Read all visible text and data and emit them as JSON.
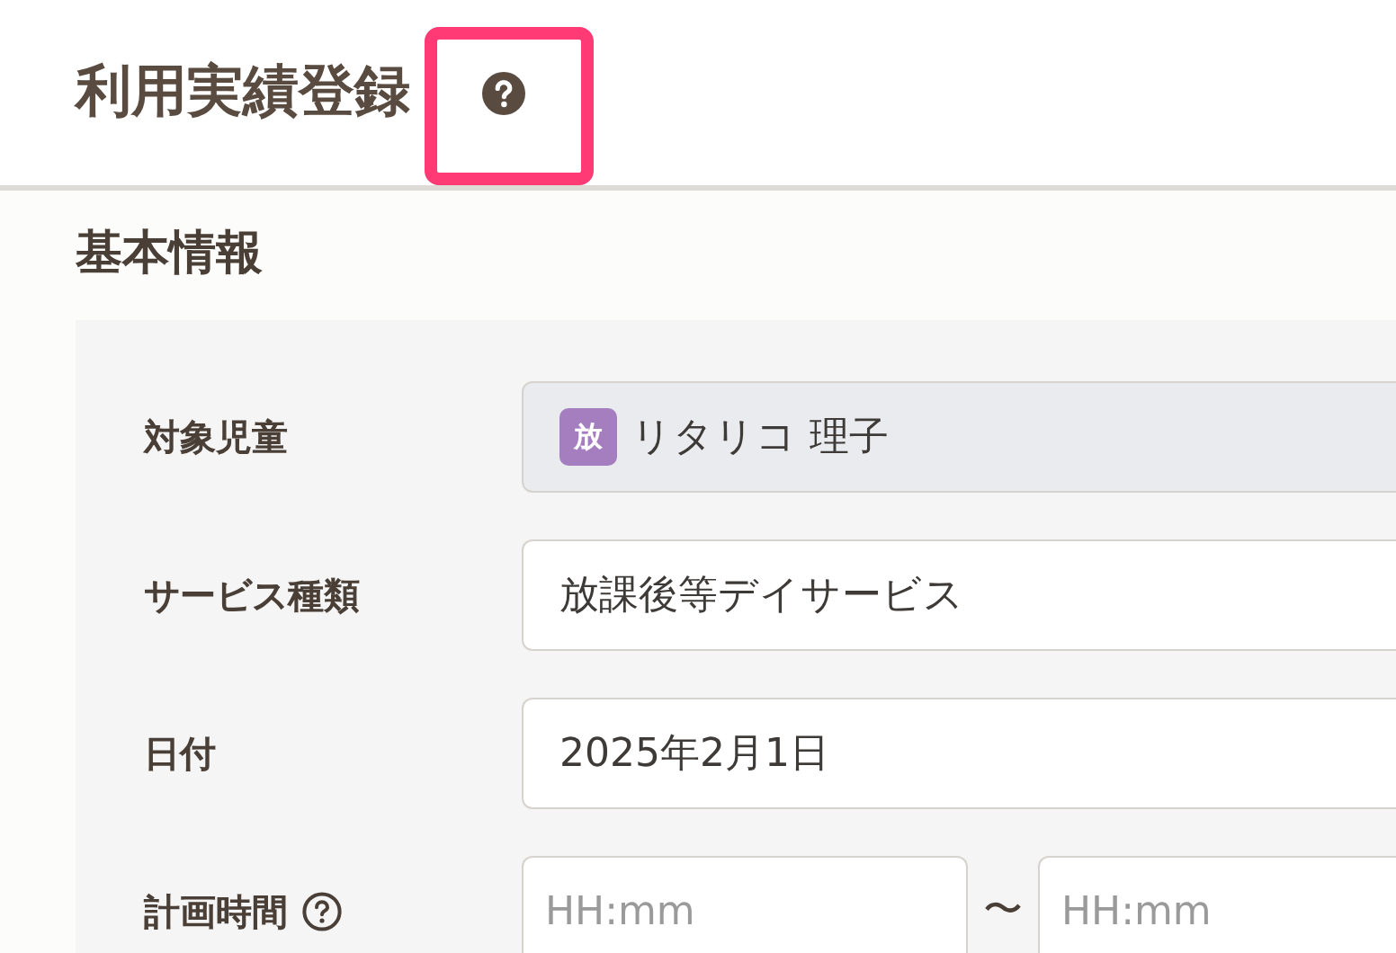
{
  "header": {
    "title": "利用実績登録",
    "help_highlighted": true
  },
  "section": {
    "title": "基本情報"
  },
  "fields": [
    {
      "kind": "readonly",
      "label": "対象児童",
      "badge": "放",
      "value": "リタリコ 理子"
    },
    {
      "kind": "text",
      "label": "サービス種類",
      "value": "放課後等デイサービス"
    },
    {
      "kind": "text",
      "label": "日付",
      "value": "2025年2月1日"
    },
    {
      "kind": "range",
      "label": "計画時間",
      "help": true,
      "from_placeholder": "HH:mm",
      "separator": "〜",
      "to_placeholder": "HH:mm"
    }
  ]
}
